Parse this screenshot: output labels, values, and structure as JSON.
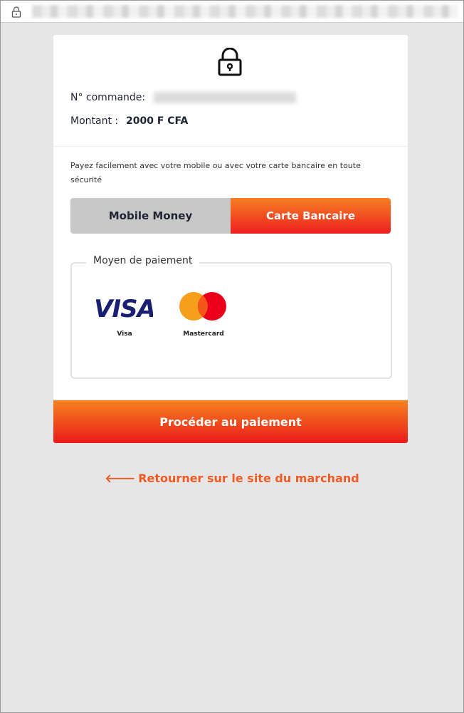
{
  "browser": {
    "url_text": ""
  },
  "order": {
    "label": "N° commande:",
    "value": ""
  },
  "amount": {
    "label": "Montant :",
    "value": "2000 F CFA"
  },
  "intro_text": "Payez facilement avec votre mobile ou avec votre carte bancaire en toute sécurité",
  "tabs": [
    {
      "label": "Mobile Money",
      "active": false
    },
    {
      "label": "Carte Bancaire",
      "active": true
    }
  ],
  "payment_methods": {
    "legend": "Moyen de paiement",
    "items": [
      {
        "logo_text": "VISA",
        "label": "Visa",
        "icon": "visa-logo"
      },
      {
        "label": "Mastercard",
        "icon": "mastercard-logo"
      }
    ]
  },
  "pay_button_label": "Procéder au paiement",
  "back_link": {
    "arrow": "🡐",
    "label": "Retourner sur le site du marchand"
  },
  "colors": {
    "accent_orange": "#f7821f",
    "accent_red": "#ea1a1a",
    "link": "#f05a23",
    "visa_blue": "#1a1f71",
    "mc_red": "#eb001b",
    "mc_orange": "#f79e1b"
  }
}
